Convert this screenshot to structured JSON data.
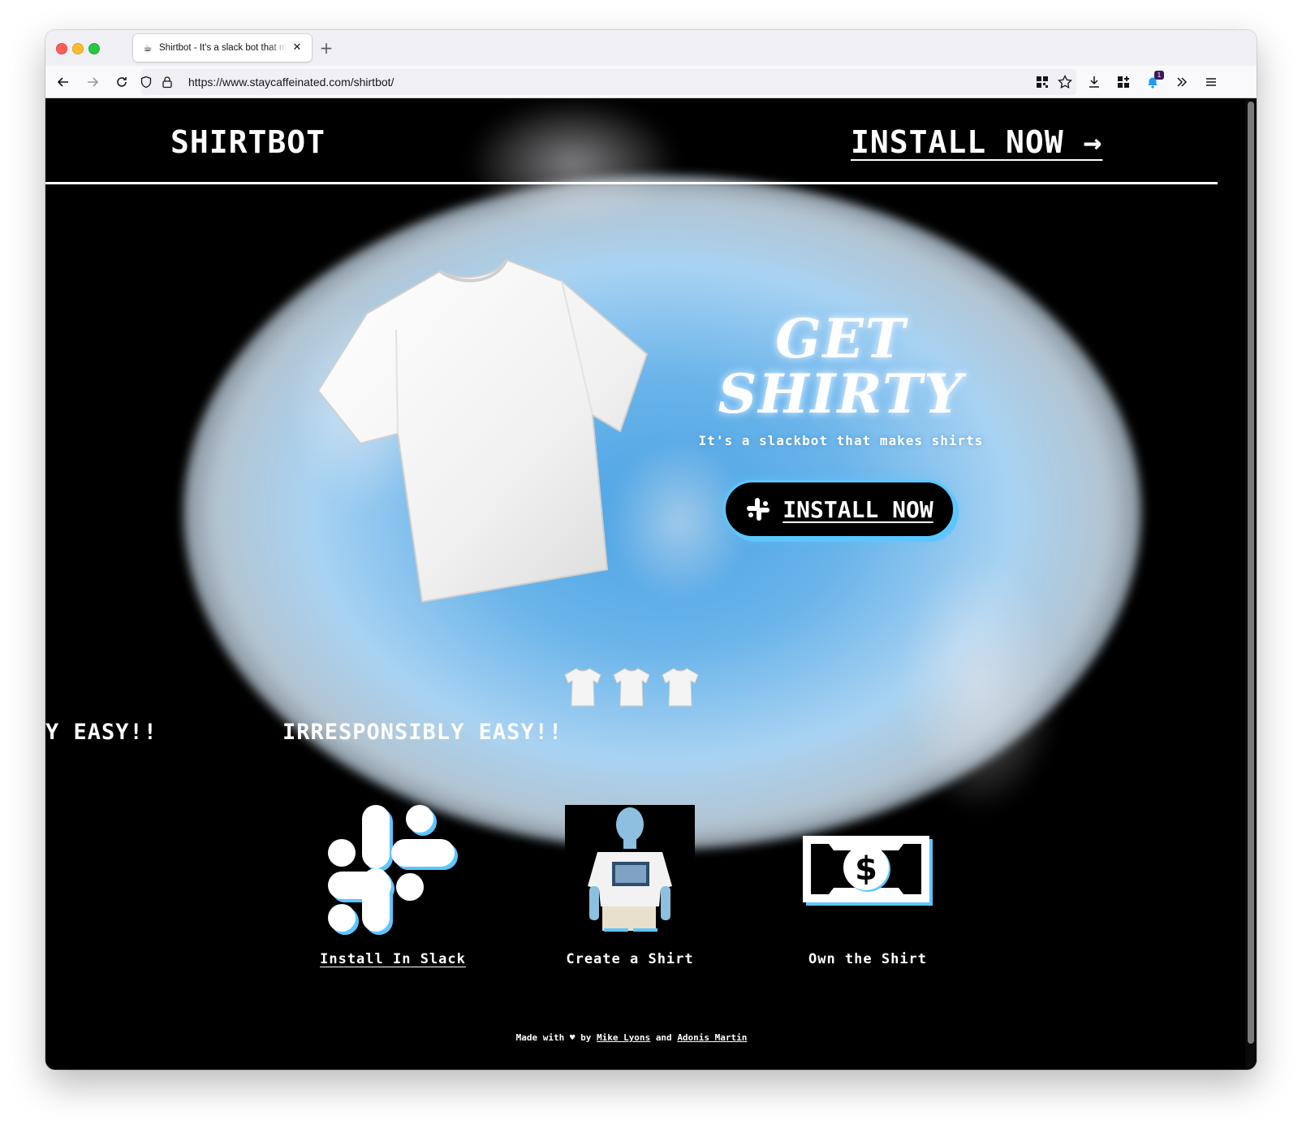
{
  "browser": {
    "tab_favicon": "☕",
    "tab_title": "Shirtbot - It's a slack bot that makes shirts",
    "tab_close": "✕",
    "new_tab": "+",
    "url": "https://www.staycaffeinated.com/shirtbot/",
    "extension_badge": "1",
    "icons": [
      "back-icon",
      "forward-icon",
      "reload-icon",
      "shield-icon",
      "lock-icon",
      "qr-icon",
      "bookmark-star-icon",
      "download-icon",
      "extensions-icon",
      "notification-extension-icon",
      "overflow-chevrons-icon",
      "menu-icon"
    ]
  },
  "header": {
    "logo": "SHIRTBOT",
    "install": "INSTALL NOW →"
  },
  "hero": {
    "headline_line1": "GET",
    "headline_line2": "SHIRTY",
    "tagline": "It's a slackbot that makes shirts",
    "cta_label": "INSTALL NOW"
  },
  "marquee": {
    "item_partial": "Y EASY!!",
    "item": "IRRESPONSIBLY EASY!!"
  },
  "features": [
    {
      "label": "Install In Slack",
      "icon": "slack-logo-icon"
    },
    {
      "label": "Create a Shirt",
      "icon": "person-in-shirt-image"
    },
    {
      "label": "Own the Shirt",
      "icon": "dollar-bill-icon"
    }
  ],
  "footer": {
    "made_with": "Made with",
    "heart": "♥",
    "by": "by",
    "author1": "Mike Lyons",
    "and": "and",
    "author2": "Adonis Martin"
  },
  "colors": {
    "accent": "#5cc6ff",
    "glow": "#4aa3e4",
    "background": "#000000"
  }
}
